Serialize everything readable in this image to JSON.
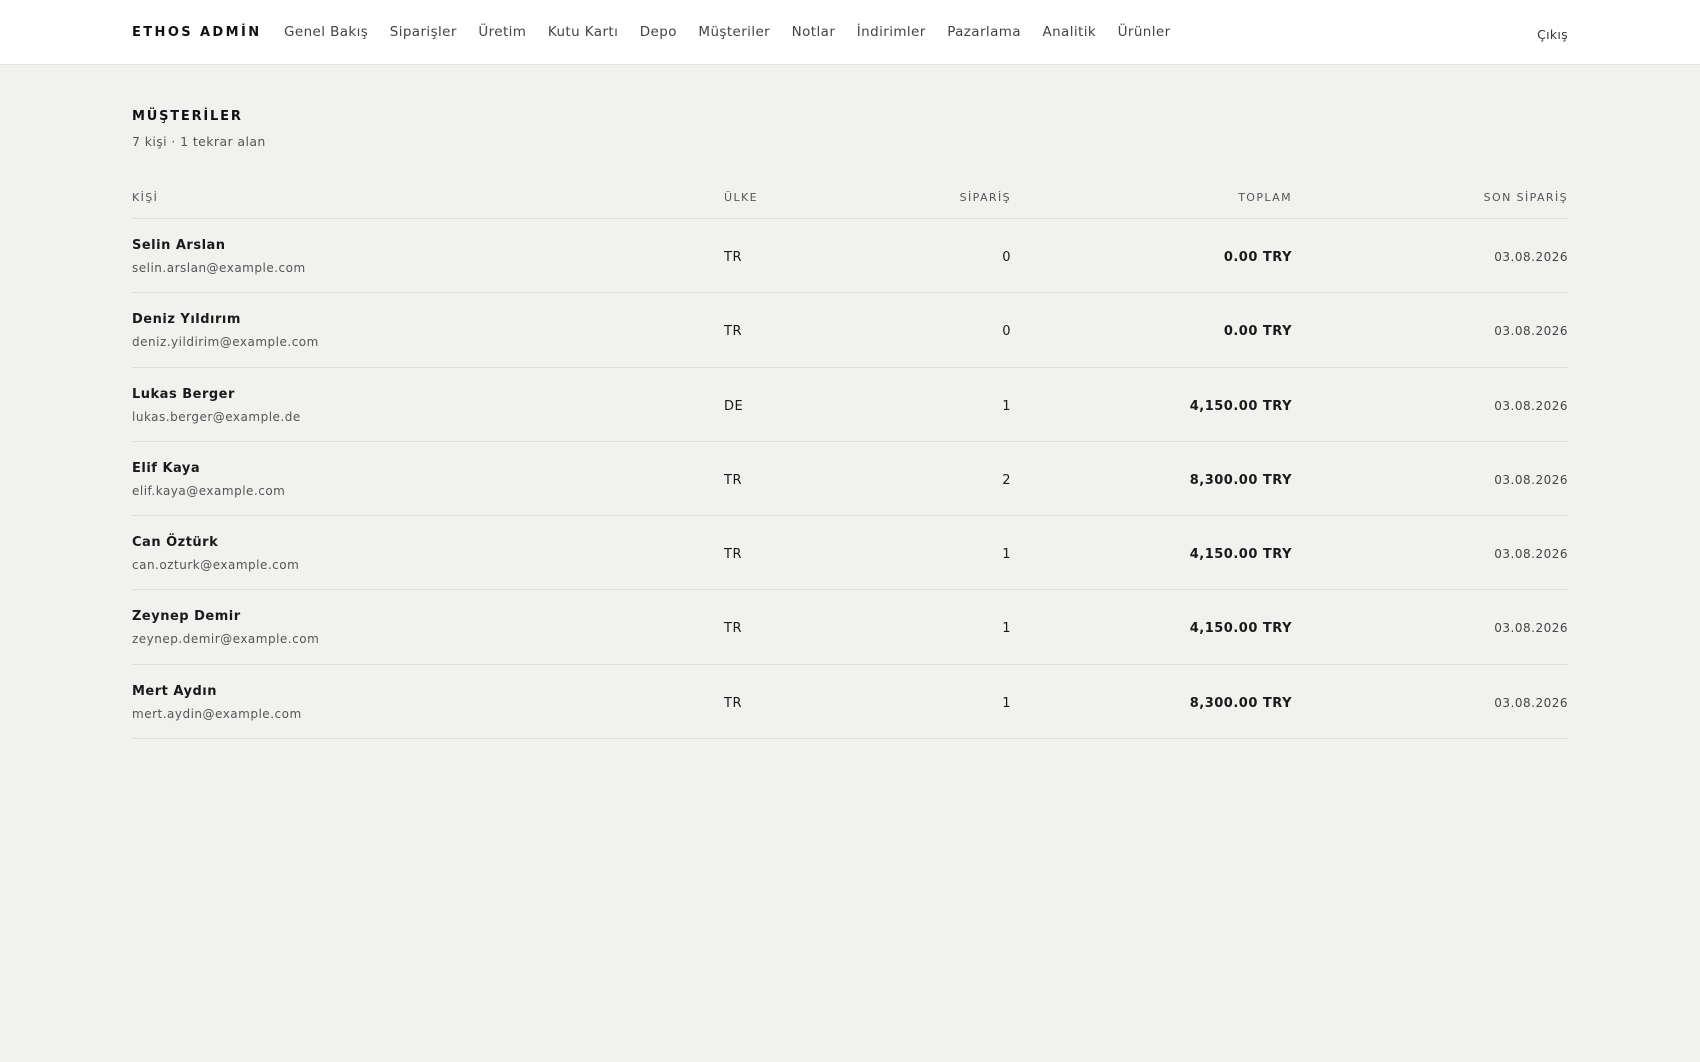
{
  "header": {
    "brand": "ETHOS ADMİN",
    "nav": [
      "Genel Bakış",
      "Siparişler",
      "Üretim",
      "Kutu Kartı",
      "Depo",
      "Müşteriler",
      "Notlar",
      "İndirimler",
      "Pazarlama",
      "Analitik",
      "Ürünler"
    ],
    "logout": "Çıkış"
  },
  "page": {
    "title": "MÜŞTERİLER",
    "subtitle": "7 kişi · 1 tekrar alan"
  },
  "table": {
    "columns": [
      "KİŞİ",
      "ÜLKE",
      "SİPARİŞ",
      "TOPLAM",
      "SON SİPARİŞ"
    ],
    "rows": [
      {
        "name": "Selin Arslan",
        "email": "selin.arslan@example.com",
        "country": "TR",
        "orders": "0",
        "total": "0.00 TRY",
        "last": "03.08.2026"
      },
      {
        "name": "Deniz Yıldırım",
        "email": "deniz.yildirim@example.com",
        "country": "TR",
        "orders": "0",
        "total": "0.00 TRY",
        "last": "03.08.2026"
      },
      {
        "name": "Lukas Berger",
        "email": "lukas.berger@example.de",
        "country": "DE",
        "orders": "1",
        "total": "4,150.00 TRY",
        "last": "03.08.2026"
      },
      {
        "name": "Elif Kaya",
        "email": "elif.kaya@example.com",
        "country": "TR",
        "orders": "2",
        "total": "8,300.00 TRY",
        "last": "03.08.2026"
      },
      {
        "name": "Can Öztürk",
        "email": "can.ozturk@example.com",
        "country": "TR",
        "orders": "1",
        "total": "4,150.00 TRY",
        "last": "03.08.2026"
      },
      {
        "name": "Zeynep Demir",
        "email": "zeynep.demir@example.com",
        "country": "TR",
        "orders": "1",
        "total": "4,150.00 TRY",
        "last": "03.08.2026"
      },
      {
        "name": "Mert Aydın",
        "email": "mert.aydin@example.com",
        "country": "TR",
        "orders": "1",
        "total": "8,300.00 TRY",
        "last": "03.08.2026"
      }
    ]
  }
}
